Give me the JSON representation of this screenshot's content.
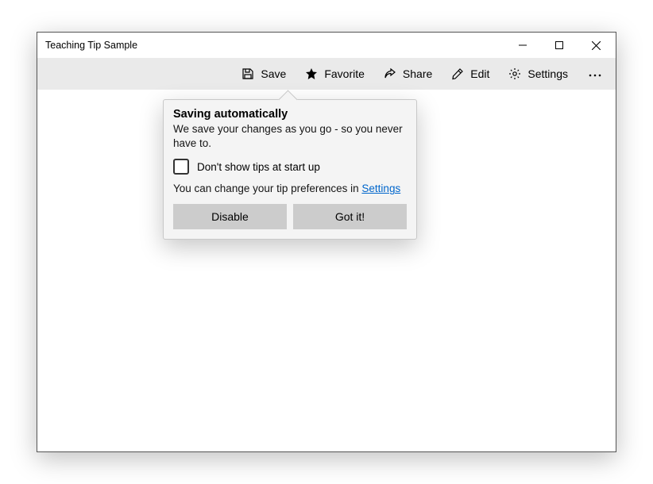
{
  "window": {
    "title": "Teaching Tip Sample"
  },
  "toolbar": {
    "save": "Save",
    "favorite": "Favorite",
    "share": "Share",
    "edit": "Edit",
    "settings": "Settings"
  },
  "tip": {
    "title": "Saving automatically",
    "subtitle": "We save your changes as you go - so you never have to.",
    "checkbox_label": "Don't show tips at start up",
    "footer_text": "You can change your tip preferences in ",
    "footer_link": "Settings",
    "btn_disable": "Disable",
    "btn_gotit": "Got it!"
  }
}
